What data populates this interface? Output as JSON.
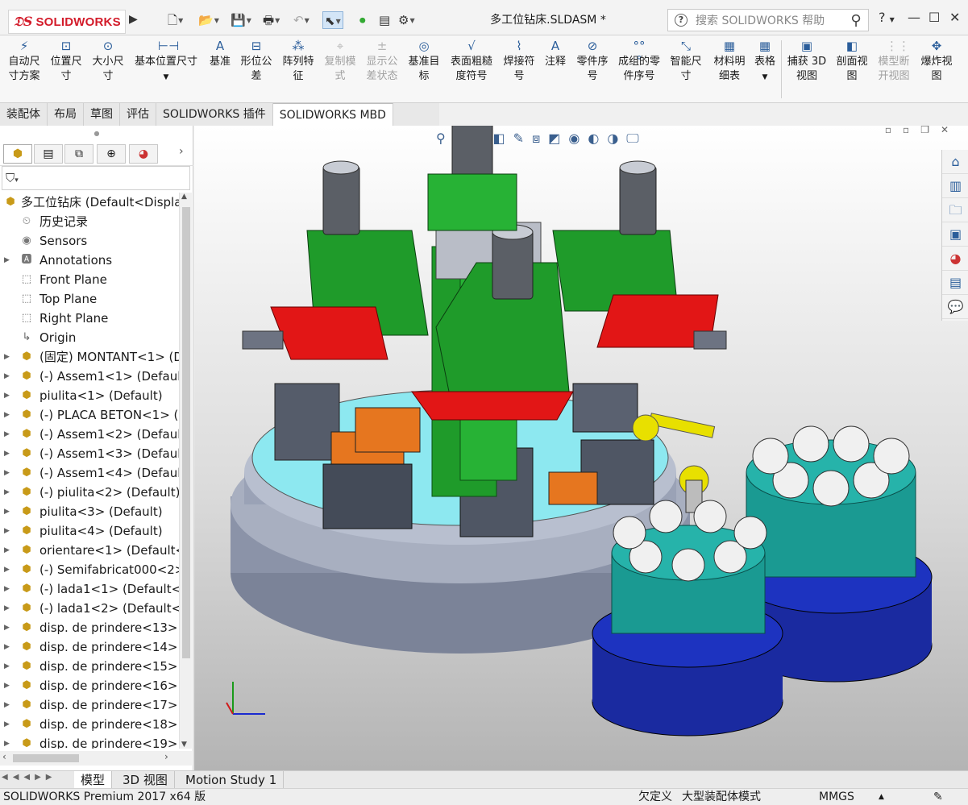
{
  "app": {
    "logo_text": "SOLIDWORKS",
    "document_title": "多工位钻床.SLDASM *"
  },
  "search": {
    "placeholder": "搜索 SOLIDWORKS 帮助"
  },
  "ribbon": {
    "items": [
      {
        "label1": "自动尺",
        "label2": "寸方案",
        "icon": "auto-dimension-icon"
      },
      {
        "label1": "位置尺",
        "label2": "寸",
        "icon": "location-dimension-icon"
      },
      {
        "label1": "大小尺",
        "label2": "寸",
        "icon": "size-dimension-icon"
      },
      {
        "label1": "基本位置尺寸",
        "label2": "",
        "icon": "basic-location-dimension-icon"
      },
      {
        "label1": "基准",
        "label2": "",
        "icon": "datum-icon"
      },
      {
        "label1": "形位公",
        "label2": "差",
        "icon": "geometric-tolerance-icon"
      },
      {
        "label1": "阵列特",
        "label2": "征",
        "icon": "pattern-feature-icon"
      },
      {
        "label1": "复制模",
        "label2": "式",
        "icon": "copy-scheme-icon"
      },
      {
        "label1": "显示公",
        "label2": "差状态",
        "icon": "show-tolerance-status-icon"
      },
      {
        "label1": "基准目",
        "label2": "标",
        "icon": "datum-target-icon"
      },
      {
        "label1": "表面粗糙",
        "label2": "度符号",
        "icon": "surface-finish-icon"
      },
      {
        "label1": "焊接符",
        "label2": "号",
        "icon": "weld-symbol-icon"
      },
      {
        "label1": "注释",
        "label2": "",
        "icon": "note-icon"
      },
      {
        "label1": "零件序",
        "label2": "号",
        "icon": "balloon-icon"
      },
      {
        "label1": "成组的零",
        "label2": "件序号",
        "icon": "stacked-balloon-icon"
      },
      {
        "label1": "智能尺",
        "label2": "寸",
        "icon": "smart-dimension-icon"
      },
      {
        "label1": "材料明",
        "label2": "细表",
        "icon": "bill-of-materials-icon"
      },
      {
        "label1": "表格",
        "label2": "",
        "icon": "table-icon"
      },
      {
        "label1": "捕获 3D",
        "label2": "视图",
        "icon": "capture-3d-view-icon"
      },
      {
        "label1": "剖面视",
        "label2": "图",
        "icon": "section-view-icon"
      },
      {
        "label1": "模型断",
        "label2": "开视图",
        "icon": "model-break-view-icon"
      },
      {
        "label1": "爆炸视",
        "label2": "图",
        "icon": "exploded-view-icon"
      }
    ]
  },
  "command_tabs": [
    "装配体",
    "布局",
    "草图",
    "评估",
    "SOLIDWORKS 插件",
    "SOLIDWORKS MBD"
  ],
  "feature_tree": {
    "root": "多工位钻床  (Default<Displa",
    "items": [
      "历史记录",
      "Sensors",
      "Annotations",
      "Front Plane",
      "Top Plane",
      "Right Plane",
      "Origin",
      "(固定) MONTANT<1> (D",
      "(-) Assem1<1> (Default",
      "piulita<1> (Default)",
      "(-) PLACA BETON<1> (D",
      "(-) Assem1<2> (Default",
      "(-) Assem1<3> (Default",
      "(-) Assem1<4> (Default",
      "(-) piulita<2> (Default)",
      "piulita<3> (Default)",
      "piulita<4> (Default)",
      "orientare<1> (Default<",
      "(-) Semifabricat000<2>",
      "(-) lada1<1> (Default<<",
      "(-) lada1<2> (Default<<",
      "disp. de prindere<13>",
      "disp. de prindere<14>",
      "disp. de prindere<15>",
      "disp. de prindere<16>",
      "disp. de prindere<17>",
      "disp. de prindere<18>",
      "disp. de prindere<19>"
    ]
  },
  "bottom_tabs": [
    "模型",
    "3D 视图",
    "Motion Study 1"
  ],
  "status": {
    "product": "SOLIDWORKS Premium 2017 x64 版",
    "definition": "欠定义",
    "mode": "大型装配体模式",
    "units": "MMGS"
  },
  "colors": {
    "brand_red": "#d31b2a",
    "model_green": "#1f9b2a",
    "model_cyan": "#8de8f0",
    "model_teal": "#1a9a92",
    "model_blue": "#1a2aa0",
    "model_grey": "#8b93a8",
    "model_red": "#e21616",
    "model_yellow": "#e8e000"
  }
}
